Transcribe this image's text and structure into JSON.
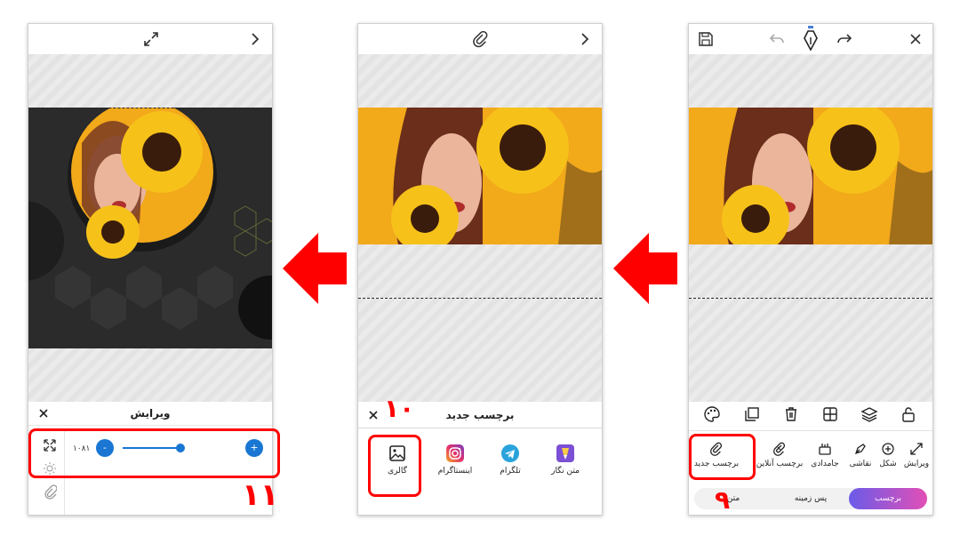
{
  "panel_left": {
    "edit_title": "ویرایش",
    "slider_value": "۱۰۸۱",
    "minus_label": "-",
    "plus_label": "+",
    "step_number": "۱۱"
  },
  "panel_middle": {
    "sheet_title": "برچسب جدید",
    "step_number": "۱۰",
    "sources": [
      {
        "label": "گالری",
        "icon": "image-icon"
      },
      {
        "label": "اینستاگرام",
        "icon": "instagram-icon"
      },
      {
        "label": "تلگرام",
        "icon": "telegram-icon"
      },
      {
        "label": "متن نگار",
        "icon": "text-pen-icon"
      }
    ]
  },
  "panel_right": {
    "tools": [
      {
        "label": "برچسب جدید",
        "icon": "paperclip-icon"
      },
      {
        "label": "برچسب آنلاین",
        "icon": "paperclip-online-icon"
      },
      {
        "label": "جامدادی",
        "icon": "pencil-case-icon"
      },
      {
        "label": "نقاشی",
        "icon": "pen-nib-icon"
      },
      {
        "label": "شکل",
        "icon": "plus-circle-icon"
      },
      {
        "label": "ویرایش",
        "icon": "expand-icon"
      }
    ],
    "tabs": [
      {
        "label": "برچسب",
        "active": true
      },
      {
        "label": "پس زمینه",
        "active": false
      },
      {
        "label": "متن",
        "active": false
      }
    ],
    "step_number": "۹"
  },
  "colors": {
    "highlight": "#ff0000",
    "accent_blue": "#1976d2",
    "tab_gradient_start": "#6a5be8",
    "tab_gradient_end": "#e24fb6",
    "photo_background": "#f2a91a"
  }
}
